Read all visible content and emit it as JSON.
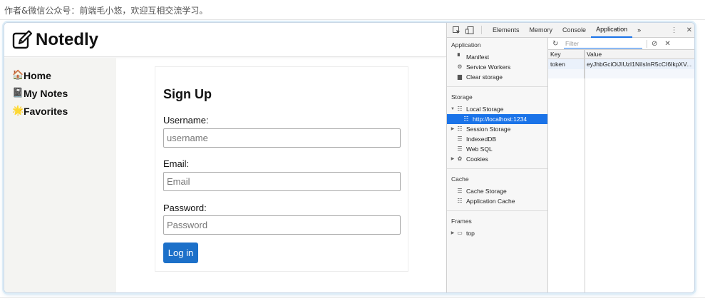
{
  "caption": "作者&微信公众号：前端毛小悠，欢迎互相交流学习。",
  "app": {
    "logo_text": "Notedly",
    "nav": [
      {
        "emoji": "🏠",
        "label": "Home"
      },
      {
        "emoji": "📓",
        "label": "My Notes"
      },
      {
        "emoji": "🌟",
        "label": "Favorites"
      }
    ],
    "form": {
      "title": "Sign Up",
      "username_label": "Username:",
      "username_placeholder": "username",
      "email_label": "Email:",
      "email_placeholder": "Email",
      "password_label": "Password:",
      "password_placeholder": "Password",
      "submit_label": "Log in"
    },
    "colors": {
      "button": "#1c70c9",
      "nav_bg": "#f4f4f2"
    }
  },
  "devtools": {
    "tabs": [
      "Elements",
      "Memory",
      "Console",
      "Application"
    ],
    "more_tabs": "»",
    "active_tab": "Application",
    "sidebar": {
      "application_title": "Application",
      "application_items": [
        "Manifest",
        "Service Workers",
        "Clear storage"
      ],
      "storage_title": "Storage",
      "local_storage": "Local Storage",
      "local_storage_child": "http://localhost:1234",
      "session_storage": "Session Storage",
      "indexeddb": "IndexedDB",
      "web_sql": "Web SQL",
      "cookies": "Cookies",
      "cache_title": "Cache",
      "cache_items": [
        "Cache Storage",
        "Application Cache"
      ],
      "frames_title": "Frames",
      "frames_item": "top"
    },
    "filter_placeholder": "Filter",
    "table": {
      "headers": {
        "key": "Key",
        "value": "Value"
      },
      "rows": [
        {
          "key": "token",
          "value": "eyJhbGciOiJIUzI1NiIsInR5cCI6IkpXV..."
        }
      ]
    },
    "colors": {
      "accent": "#1a73e8"
    }
  }
}
